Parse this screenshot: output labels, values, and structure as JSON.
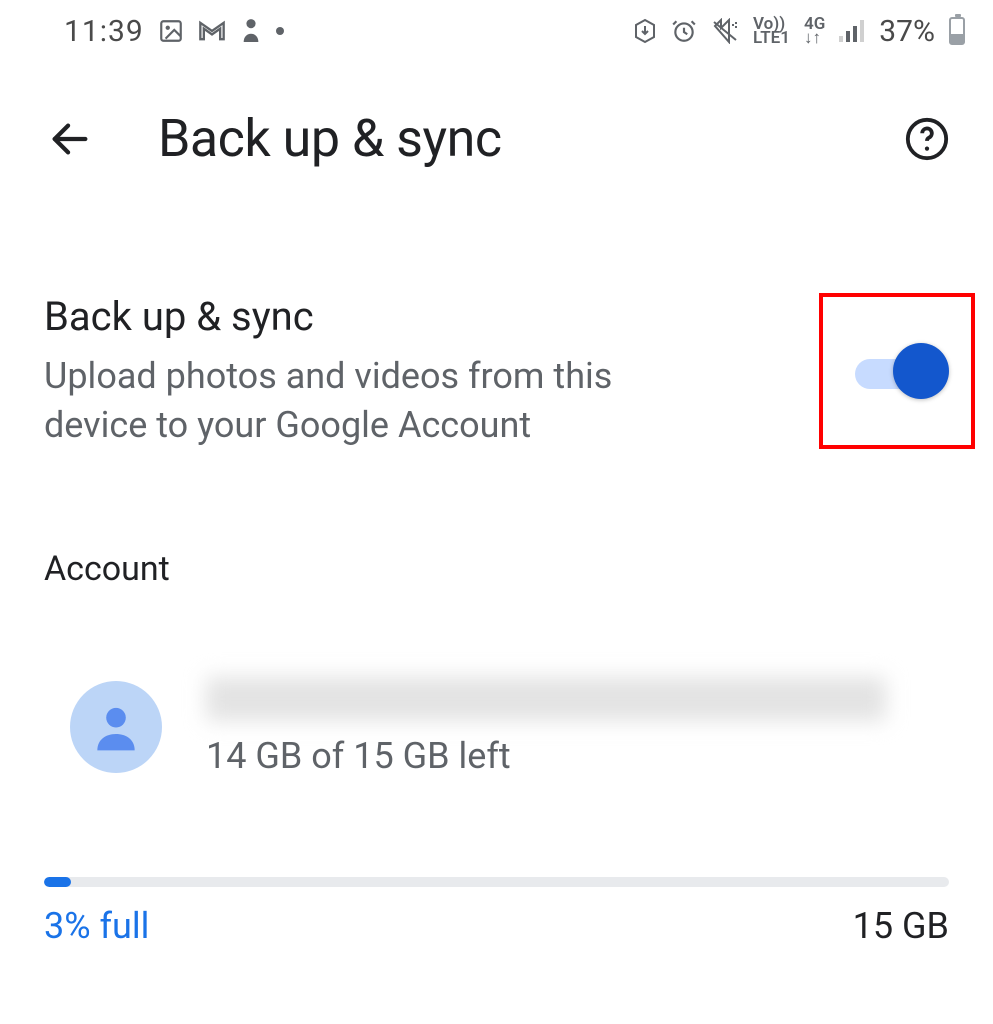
{
  "statusbar": {
    "time": "11:39",
    "battery_pct": "37%",
    "net1_top": "Vo))",
    "net1_bot": "LTE1",
    "net2_top": "4G",
    "net2_bot": "↓↑"
  },
  "appbar": {
    "title": "Back up & sync"
  },
  "setting": {
    "title": "Back up & sync",
    "subtitle": "Upload photos and videos from this device to your Google Account",
    "enabled": true
  },
  "account": {
    "section_label": "Account",
    "storage_left_text": "14 GB of 15 GB left"
  },
  "storage": {
    "percent_full_label": "3% full",
    "total_label": "15 GB",
    "percent_full": 3
  }
}
